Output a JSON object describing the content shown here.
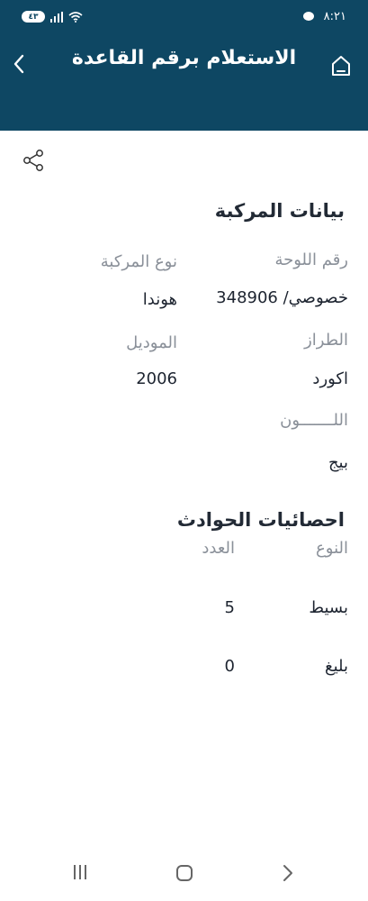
{
  "status_bar": {
    "time": "٨:٢١",
    "battery": "٤٣",
    "icons": [
      "chat-icon",
      "signal-icon",
      "wifi-icon",
      "battery-icon"
    ]
  },
  "header": {
    "title": "الاستعلام برقم القاعدة",
    "back_icon": "chevron-left-icon",
    "home_icon": "home-icon",
    "background": "#0e4763"
  },
  "share_icon": "share-icon",
  "vehicle": {
    "section_title": "بيانات المركبة",
    "plate_label": "رقم اللوحة",
    "plate_value": "خصوصي/ 348906",
    "type_label": "نوع المركبة",
    "type_value": "هوندا",
    "class_label": "الطراز",
    "class_value": "اكورد",
    "model_label": "الموديل",
    "model_value": "2006",
    "color_label": "اللـــــــون",
    "color_value": "بيج"
  },
  "accidents": {
    "section_title": "احصائيات الحوادث",
    "col_type": "النوع",
    "col_count": "العدد",
    "rows": [
      {
        "type": "بسيط",
        "count": "5"
      },
      {
        "type": "بليغ",
        "count": "0"
      }
    ]
  },
  "navbar": {
    "icons": [
      "recent-apps-icon",
      "home-nav-icon",
      "back-nav-icon"
    ]
  }
}
